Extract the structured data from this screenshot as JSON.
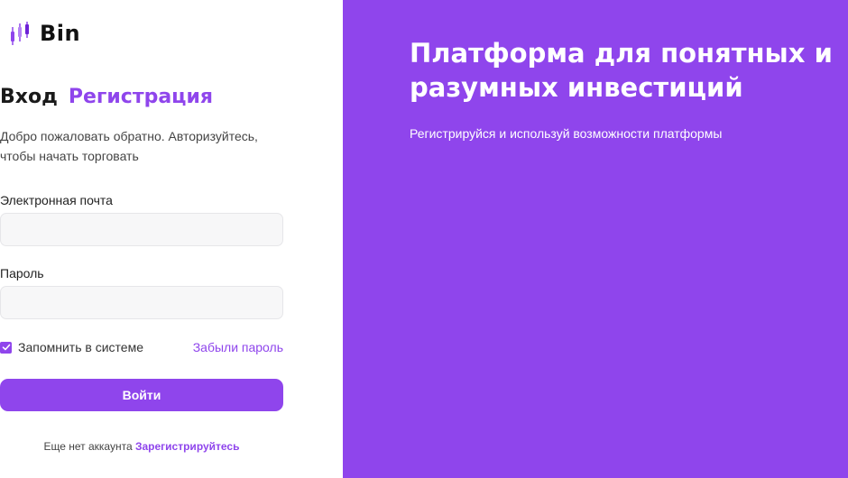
{
  "brand": {
    "name": "Bin",
    "accent": "#8f45ec"
  },
  "auth": {
    "tab_login": "Вход",
    "tab_register": "Регистрация",
    "subtitle": "Добро пожаловать обратно. Авторизуйтесь, чтобы начать торговать"
  },
  "form": {
    "email_label": "Электронная почта",
    "email_value": "",
    "password_label": "Пароль",
    "password_value": "",
    "remember_label": "Запомнить в системе",
    "remember_checked": true,
    "forgot_label": "Забыли пароль",
    "submit_label": "Войти",
    "no_account_text": "Еще нет аккаунта",
    "signup_link": "Зарегистрируйтесь"
  },
  "hero": {
    "title": "Платформа для понятных и разумных инвестиций",
    "subtitle": "Регистрируйся и используй возможности платформы"
  }
}
